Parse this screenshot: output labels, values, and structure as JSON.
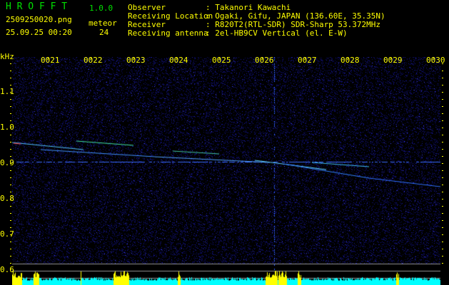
{
  "app": {
    "name": "H R O F F T",
    "version": "1.0.0"
  },
  "file": {
    "name": "2509250020.png",
    "datetime": "25.09.25 00:20"
  },
  "meteor": {
    "label": "meteor",
    "count": "24"
  },
  "info": [
    {
      "label": "Observer",
      "value": ": Takanori Kawachi"
    },
    {
      "label": "Receiving Location",
      "value": ": Ogaki, Gifu, JAPAN (136.60E, 35.35N)"
    },
    {
      "label": "Receiver",
      "value": ": R820T2(RTL-SDR) SDR-Sharp 53.372MHz"
    },
    {
      "label": "Receiving antenna",
      "value": ": 2el-HB9CV Vertical (el. E-W)"
    }
  ],
  "axis": {
    "y_unit": "kHz",
    "y_ticks": [
      "1.1",
      "1.0",
      "0.9",
      "0.8",
      "0.7",
      "0.6"
    ],
    "x_ticks": [
      "0021",
      "0022",
      "0023",
      "0024",
      "0025",
      "0026",
      "0027",
      "0028",
      "0029",
      "0030"
    ]
  },
  "colors": {
    "text": "#ffff00",
    "title": "#00e000",
    "noise": "#1a1aa0",
    "histogram": "#00ffff",
    "histogram_peak": "#ffff00"
  }
}
